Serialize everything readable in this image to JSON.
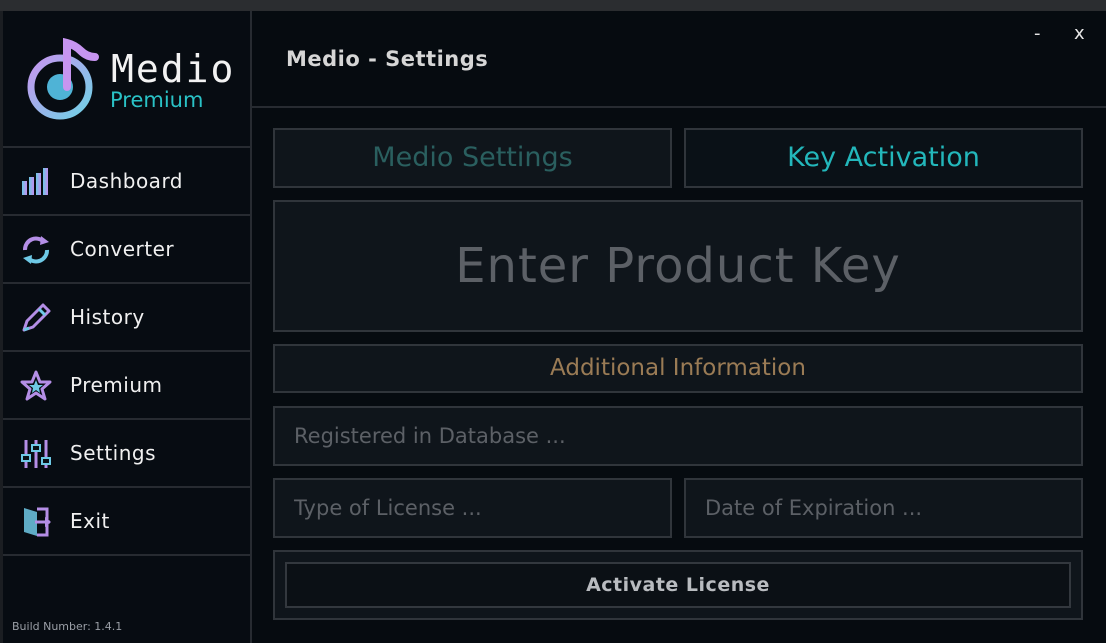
{
  "app": {
    "logo_title": "Medio",
    "logo_subtitle": "Premium",
    "window_title": "Medio - Settings",
    "minimize": "-",
    "close": "x",
    "build": "Build Number: 1.4.1"
  },
  "sidebar": {
    "items": [
      {
        "label": "Dashboard",
        "icon": "bar-chart-icon"
      },
      {
        "label": "Converter",
        "icon": "refresh-icon"
      },
      {
        "label": "History",
        "icon": "pencil-icon"
      },
      {
        "label": "Premium",
        "icon": "star-icon"
      },
      {
        "label": "Settings",
        "icon": "sliders-icon"
      },
      {
        "label": "Exit",
        "icon": "exit-door-icon"
      }
    ]
  },
  "tabs": {
    "settings": "Medio Settings",
    "key_activation": "Key Activation"
  },
  "form": {
    "product_key_placeholder": "Enter Product Key",
    "additional_info": "Additional Information",
    "registered_placeholder": "Registered in Database ...",
    "license_type_placeholder": "Type of License ...",
    "expiration_placeholder": "Date of Expiration ...",
    "activate_label": "Activate License"
  },
  "colors": {
    "accent": "#23b7bb",
    "purple": "#b48ee6",
    "gold": "#9a7b55",
    "background": "#060b10"
  }
}
